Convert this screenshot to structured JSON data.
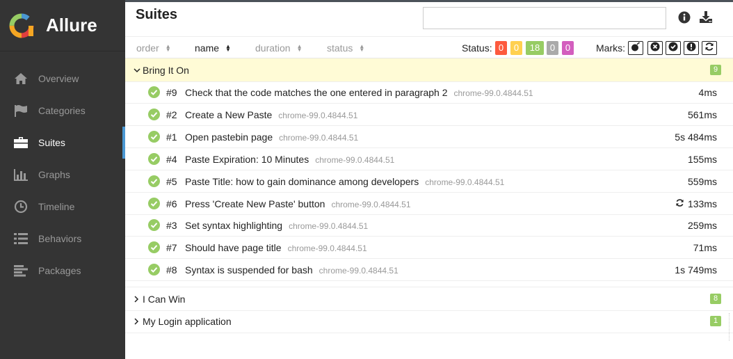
{
  "app": {
    "name": "Allure"
  },
  "sidebar": {
    "items": [
      {
        "label": "Overview",
        "icon": "home-icon"
      },
      {
        "label": "Categories",
        "icon": "flag-icon"
      },
      {
        "label": "Suites",
        "icon": "briefcase-icon",
        "active": true
      },
      {
        "label": "Graphs",
        "icon": "bar-chart-icon"
      },
      {
        "label": "Timeline",
        "icon": "clock-icon"
      },
      {
        "label": "Behaviors",
        "icon": "list-icon"
      },
      {
        "label": "Packages",
        "icon": "align-left-icon"
      }
    ]
  },
  "header": {
    "title": "Suites",
    "search_value": ""
  },
  "toolbar": {
    "sort": [
      {
        "label": "order"
      },
      {
        "label": "name",
        "active": true
      },
      {
        "label": "duration"
      },
      {
        "label": "status"
      }
    ],
    "status_label": "Status:",
    "status_counts": [
      {
        "value": "0",
        "color": "#fd5a3e"
      },
      {
        "value": "0",
        "color": "#ffd050"
      },
      {
        "value": "18",
        "color": "#97cc64"
      },
      {
        "value": "0",
        "color": "#aaaaaa"
      },
      {
        "value": "0",
        "color": "#d35ebe"
      }
    ],
    "marks_label": "Marks:"
  },
  "groups": [
    {
      "name": "Bring It On",
      "count": "9",
      "expanded": true,
      "tests": [
        {
          "num": "#9",
          "name": "Check that the code matches the one entered in paragraph 2",
          "env": "chrome-99.0.4844.51",
          "duration": "4ms"
        },
        {
          "num": "#2",
          "name": "Create a New Paste",
          "env": "chrome-99.0.4844.51",
          "duration": "561ms"
        },
        {
          "num": "#1",
          "name": "Open pastebin page",
          "env": "chrome-99.0.4844.51",
          "duration": "5s 484ms"
        },
        {
          "num": "#4",
          "name": "Paste Expiration: 10 Minutes",
          "env": "chrome-99.0.4844.51",
          "duration": "155ms"
        },
        {
          "num": "#5",
          "name": "Paste Title: how to gain dominance among developers",
          "env": "chrome-99.0.4844.51",
          "duration": "559ms"
        },
        {
          "num": "#6",
          "name": "Press 'Create New Paste' button",
          "env": "chrome-99.0.4844.51",
          "duration": "133ms",
          "retried": true
        },
        {
          "num": "#3",
          "name": "Set syntax highlighting",
          "env": "chrome-99.0.4844.51",
          "duration": "259ms"
        },
        {
          "num": "#7",
          "name": "Should have page title",
          "env": "chrome-99.0.4844.51",
          "duration": "71ms"
        },
        {
          "num": "#8",
          "name": "Syntax is suspended for bash",
          "env": "chrome-99.0.4844.51",
          "duration": "1s 749ms"
        }
      ]
    },
    {
      "name": "I Can Win",
      "count": "8",
      "expanded": false
    },
    {
      "name": "My Login application",
      "count": "1",
      "expanded": false
    }
  ],
  "colors": {
    "passed": "#97cc64",
    "sidebar_bg": "#343434",
    "accent": "#4a97d2",
    "highlight": "#fffbd6"
  }
}
